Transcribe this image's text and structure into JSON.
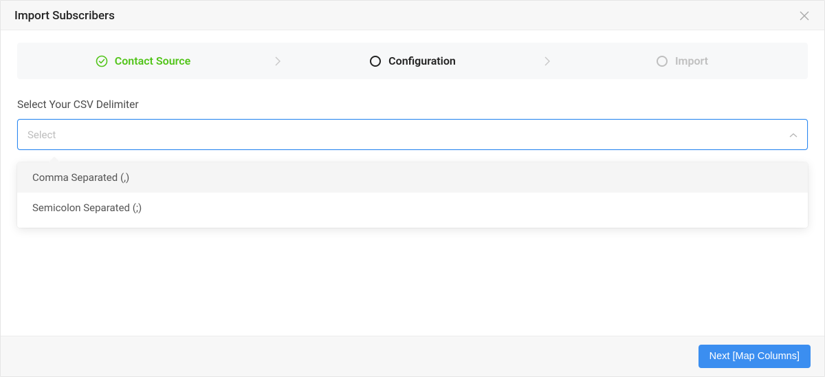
{
  "modal": {
    "title": "Import Subscribers"
  },
  "stepper": {
    "steps": [
      {
        "label": "Contact Source",
        "state": "completed"
      },
      {
        "label": "Configuration",
        "state": "current"
      },
      {
        "label": "Import",
        "state": "upcoming"
      }
    ]
  },
  "form": {
    "delimiter_label": "Select Your CSV Delimiter",
    "select_placeholder": "Select",
    "options": [
      {
        "label": "Comma Separated (,)",
        "highlighted": true
      },
      {
        "label": "Semicolon Separated (;)",
        "highlighted": false
      }
    ]
  },
  "footer": {
    "next_label": "Next [Map Columns]"
  },
  "colors": {
    "accent_green": "#52c41a",
    "accent_blue": "#3b8ef0",
    "focus_blue": "#2b88f0"
  }
}
